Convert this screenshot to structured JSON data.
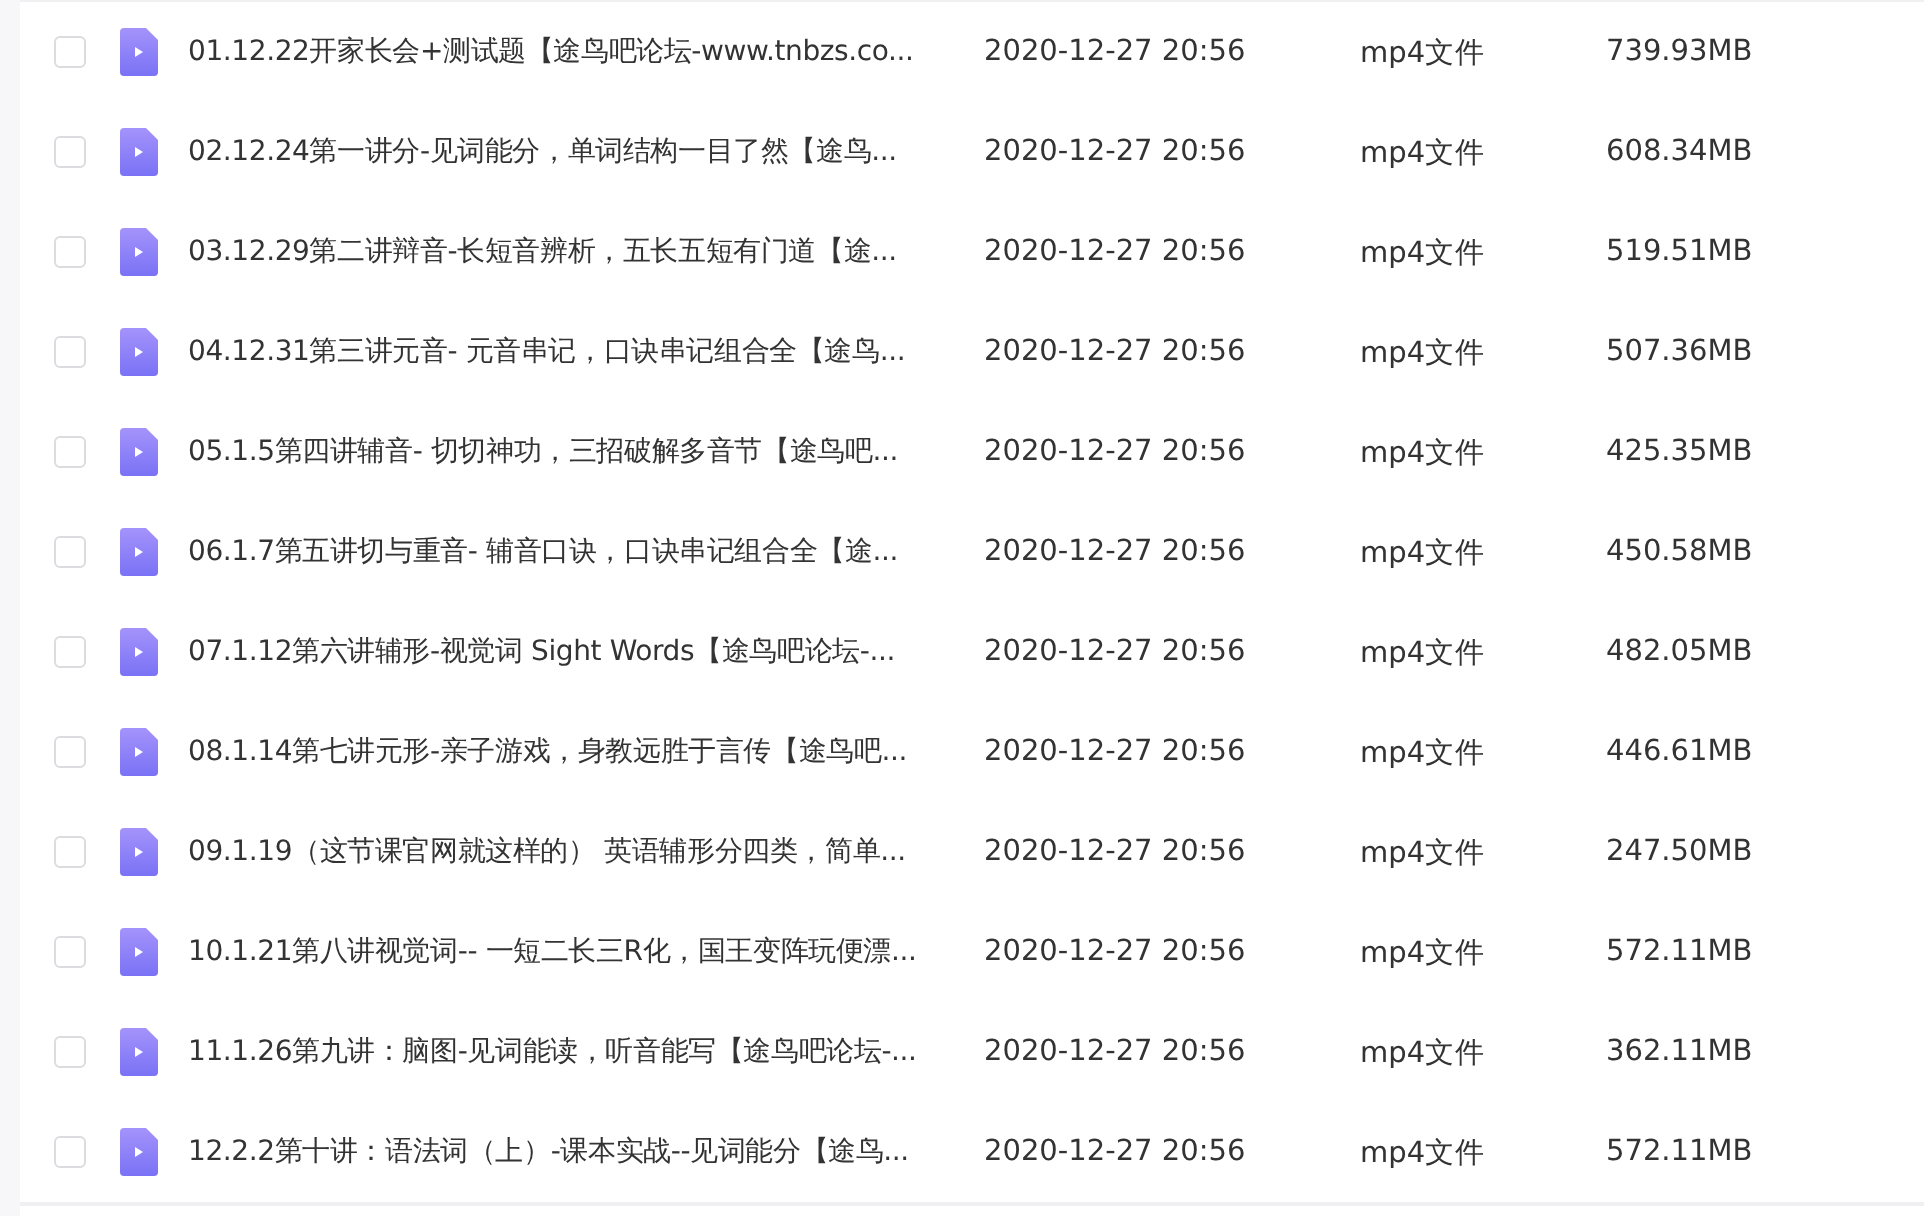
{
  "files": [
    {
      "name": "01.12.22开家长会+测试题【途鸟吧论坛-www.tnbzs.co...",
      "date": "2020-12-27 20:56",
      "type": "mp4文件",
      "size": "739.93MB",
      "checked": false
    },
    {
      "name": "02.12.24第一讲分-见词能分，单词结构一目了然【途鸟...",
      "date": "2020-12-27 20:56",
      "type": "mp4文件",
      "size": "608.34MB",
      "checked": false
    },
    {
      "name": "03.12.29第二讲辩音-长短音辨析，五长五短有门道【途...",
      "date": "2020-12-27 20:56",
      "type": "mp4文件",
      "size": "519.51MB",
      "checked": false
    },
    {
      "name": "04.12.31第三讲元音- 元音串记，口诀串记组合全【途鸟...",
      "date": "2020-12-27 20:56",
      "type": "mp4文件",
      "size": "507.36MB",
      "checked": false
    },
    {
      "name": "05.1.5第四讲辅音- 切切神功，三招破解多音节【途鸟吧...",
      "date": "2020-12-27 20:56",
      "type": "mp4文件",
      "size": "425.35MB",
      "checked": false
    },
    {
      "name": "06.1.7第五讲切与重音- 辅音口诀，口诀串记组合全【途...",
      "date": "2020-12-27 20:56",
      "type": "mp4文件",
      "size": "450.58MB",
      "checked": false
    },
    {
      "name": "07.1.12第六讲辅形-视觉词 Sight Words【途鸟吧论坛-...",
      "date": "2020-12-27 20:56",
      "type": "mp4文件",
      "size": "482.05MB",
      "checked": false
    },
    {
      "name": "08.1.14第七讲元形-亲子游戏，身教远胜于言传【途鸟吧...",
      "date": "2020-12-27 20:56",
      "type": "mp4文件",
      "size": "446.61MB",
      "checked": false
    },
    {
      "name": "09.1.19（这节课官网就这样的） 英语辅形分四类，简单...",
      "date": "2020-12-27 20:56",
      "type": "mp4文件",
      "size": "247.50MB",
      "checked": false
    },
    {
      "name": "10.1.21第八讲视觉词-- 一短二长三R化，国王变阵玩便漂...",
      "date": "2020-12-27 20:56",
      "type": "mp4文件",
      "size": "572.11MB",
      "checked": false
    },
    {
      "name": "11.1.26第九讲：脑图-见词能读，听音能写【途鸟吧论坛-...",
      "date": "2020-12-27 20:56",
      "type": "mp4文件",
      "size": "362.11MB",
      "checked": false
    },
    {
      "name": "12.2.2第十讲：语法词（上）-课本实战--见词能分【途鸟...",
      "date": "2020-12-27 20:56",
      "type": "mp4文件",
      "size": "572.11MB",
      "checked": false
    }
  ]
}
